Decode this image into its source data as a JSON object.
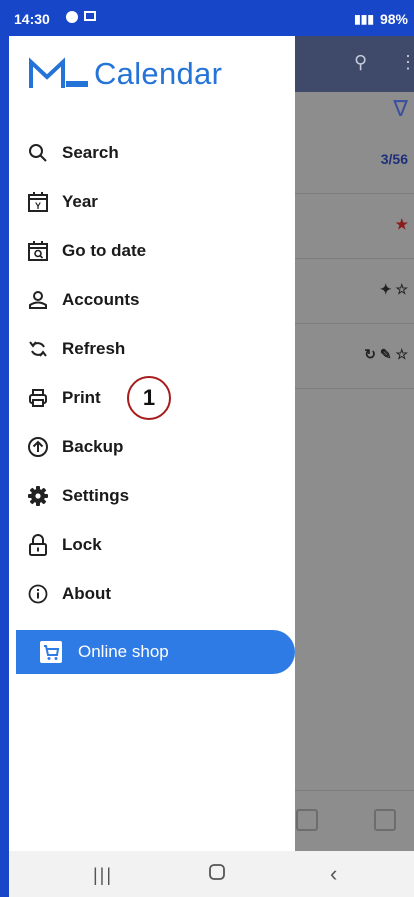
{
  "status_bar": {
    "time": "14:30",
    "battery": "98%"
  },
  "drawer": {
    "logo_text": "Calendar",
    "items": [
      {
        "label": "Search",
        "icon": "search-icon"
      },
      {
        "label": "Year",
        "icon": "calendar-year-icon"
      },
      {
        "label": "Go to date",
        "icon": "calendar-search-icon"
      },
      {
        "label": "Accounts",
        "icon": "person-icon"
      },
      {
        "label": "Refresh",
        "icon": "refresh-icon"
      },
      {
        "label": "Print",
        "icon": "print-icon"
      },
      {
        "label": "Backup",
        "icon": "backup-icon"
      },
      {
        "label": "Settings",
        "icon": "gear-icon"
      },
      {
        "label": "Lock",
        "icon": "lock-icon"
      },
      {
        "label": "About",
        "icon": "info-icon"
      }
    ],
    "shop_label": "Online shop"
  },
  "background_app": {
    "row1_meta": "3/56"
  },
  "annotation": {
    "number": "1"
  },
  "colors": {
    "accent": "#2474d8",
    "shop_bg": "#2f7be6",
    "frame_blue": "#1746c9"
  }
}
